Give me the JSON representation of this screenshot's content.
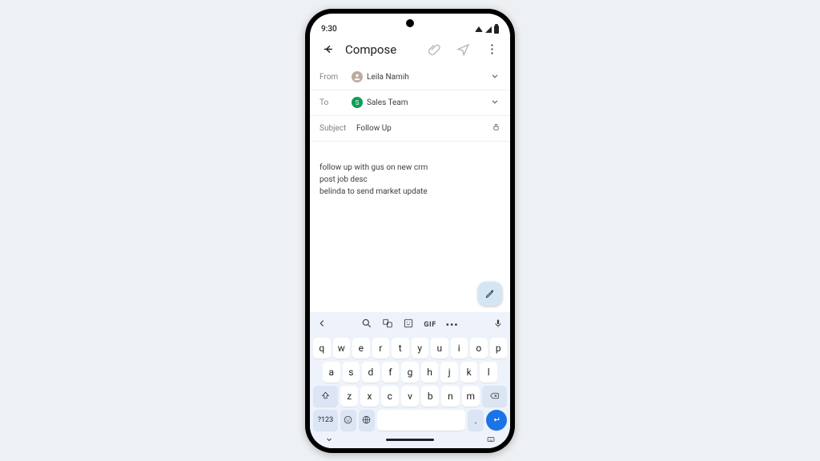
{
  "statusbar": {
    "time": "9:30"
  },
  "header": {
    "title": "Compose"
  },
  "from": {
    "label": "From",
    "name": "Leila Namih"
  },
  "to": {
    "label": "To",
    "chip_letter": "S",
    "chip_name": "Sales Team"
  },
  "subject": {
    "label": "Subject",
    "value": "Follow Up"
  },
  "body": "follow up with gus on new crm\npost job desc\nbelinda to send market update",
  "keyboard": {
    "toolbar": {
      "gif": "GIF",
      "more": "•••"
    },
    "row1": [
      "q",
      "w",
      "e",
      "r",
      "t",
      "y",
      "u",
      "i",
      "o",
      "p"
    ],
    "row2": [
      "a",
      "s",
      "d",
      "f",
      "g",
      "h",
      "j",
      "k",
      "l"
    ],
    "row3": [
      "z",
      "x",
      "c",
      "v",
      "b",
      "n",
      "m"
    ],
    "numkey": "?123",
    "period": "."
  }
}
